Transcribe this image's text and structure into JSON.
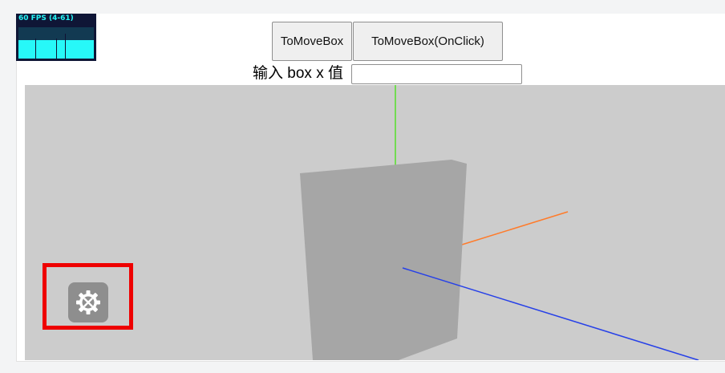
{
  "stats": {
    "fps_text": "60 FPS (4-61)",
    "fps_fill_fraction": 0.6,
    "colors": {
      "background": "#0f1636",
      "foreground": "#27f5f5"
    }
  },
  "toolbar": {
    "move_button_label": "ToMoveBox",
    "move_onclick_button_label": "ToMoveBox(OnClick)"
  },
  "box_x_input": {
    "label": "输入 box x 值",
    "value": "",
    "placeholder": ""
  },
  "scene": {
    "background_color": "#cccccc",
    "box_color": "#a6a6a6",
    "axes_colors": {
      "x": "#ff5a1f",
      "y": "#55e02a",
      "z": "#2640e8"
    }
  },
  "settings": {
    "icon": "gear-wrench-icon",
    "highlight_color": "#ee0000"
  }
}
